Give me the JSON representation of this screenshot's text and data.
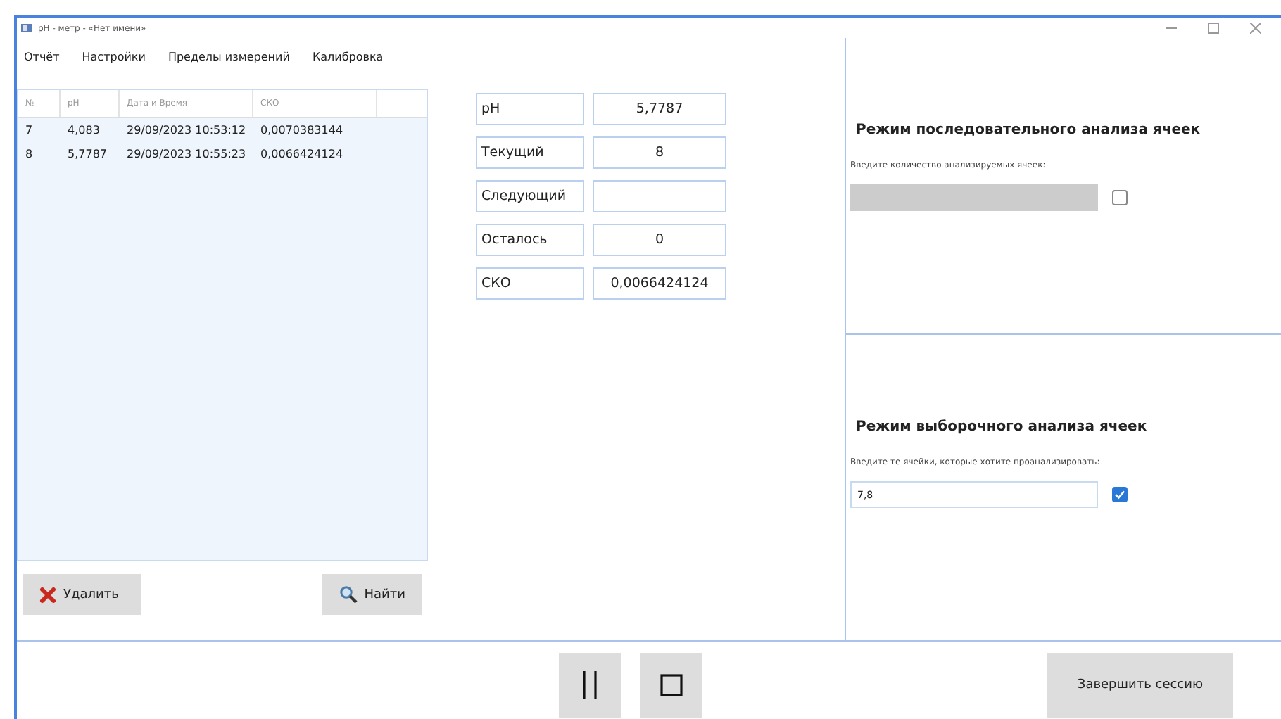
{
  "window": {
    "title": "pH - метр - «Нет имени»"
  },
  "menu": [
    "Отчёт",
    "Настройки",
    "Пределы измерений",
    "Калибровка"
  ],
  "table": {
    "columns": [
      "№",
      "pH",
      "Дата и Время",
      "СКО"
    ],
    "rows": [
      {
        "cells": [
          "7",
          "4,083",
          "29/09/2023 10:53:12",
          "0,0070383144"
        ],
        "selected": false
      },
      {
        "cells": [
          "8",
          "5,7787",
          "29/09/2023 10:55:23",
          "0,0066424124"
        ],
        "selected": false
      }
    ]
  },
  "table_buttons": [
    {
      "kind": "delete",
      "label": "Удалить"
    },
    {
      "kind": "find",
      "label": "Найти"
    }
  ],
  "readings": [
    {
      "label": "pH",
      "value": "5,7787"
    },
    {
      "label": "Текущий",
      "value": "8"
    },
    {
      "label": "Следующий"
    },
    {
      "label": "Осталось",
      "value": "0"
    },
    {
      "label": "СКО",
      "value": "0,0066424124"
    }
  ],
  "modes": [
    {
      "title": "Режим последовательного анализа ячеек",
      "prompt": "Введите количество анализируемых ячеек:",
      "disabled": true,
      "checked": false
    },
    {
      "title": "Режим выборочного анализа ячеек",
      "prompt": "Введите те ячейки, которые хотите проанализировать:",
      "value": "7,8",
      "disabled": false,
      "checked": true
    }
  ],
  "controls": [
    {
      "kind": "pause"
    },
    {
      "kind": "stop"
    }
  ],
  "finish_button": "Завершить сессию"
}
